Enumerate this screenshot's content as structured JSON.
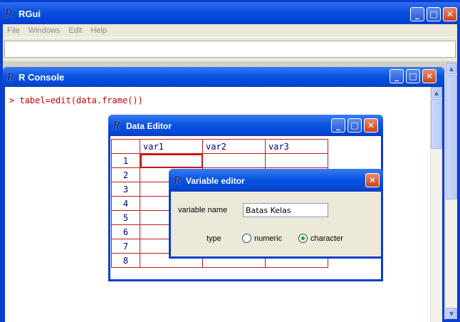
{
  "app": {
    "logo": "R",
    "title": "RGui",
    "menu": [
      "File",
      "Windows",
      "Edit",
      "Help"
    ]
  },
  "console": {
    "title": "R Console",
    "prompt": ">",
    "command": "tabel=edit(data.frame())"
  },
  "data_editor": {
    "title": "Data Editor",
    "columns": [
      "var1",
      "var2",
      "var3"
    ],
    "rows": [
      "1",
      "2",
      "3",
      "4",
      "5",
      "6",
      "7",
      "8"
    ]
  },
  "variable_editor": {
    "title": "Variable editor",
    "name_label": "variable name",
    "name_value": "Batas Kelas",
    "type_label": "type",
    "options": [
      {
        "label": "numeric",
        "selected": false
      },
      {
        "label": "character",
        "selected": true
      }
    ]
  },
  "icons": {
    "minimize": "minimize-icon",
    "maximize": "maximize-icon",
    "close": "close-icon",
    "scroll_up": "scroll-up-arrow-icon",
    "scroll_down": "scroll-down-arrow-icon"
  },
  "colors": {
    "titlebar_blue": "#0a4fdb",
    "console_text": "#d00000",
    "grid_border": "#c41818",
    "header_text": "#000080",
    "dialog_bg": "#ece9d8"
  }
}
